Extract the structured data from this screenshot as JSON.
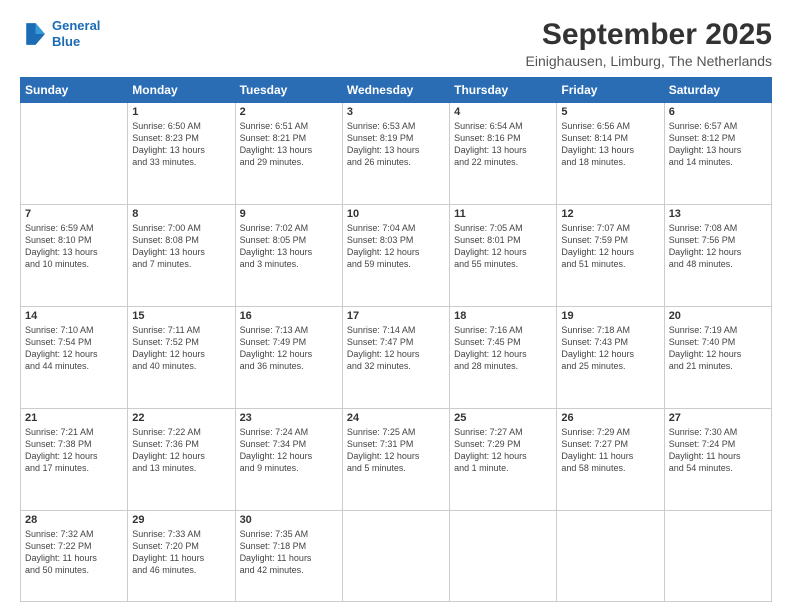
{
  "logo": {
    "line1": "General",
    "line2": "Blue"
  },
  "title": "September 2025",
  "subtitle": "Einighausen, Limburg, The Netherlands",
  "days_header": [
    "Sunday",
    "Monday",
    "Tuesday",
    "Wednesday",
    "Thursday",
    "Friday",
    "Saturday"
  ],
  "weeks": [
    [
      {
        "num": "",
        "info": ""
      },
      {
        "num": "1",
        "info": "Sunrise: 6:50 AM\nSunset: 8:23 PM\nDaylight: 13 hours\nand 33 minutes."
      },
      {
        "num": "2",
        "info": "Sunrise: 6:51 AM\nSunset: 8:21 PM\nDaylight: 13 hours\nand 29 minutes."
      },
      {
        "num": "3",
        "info": "Sunrise: 6:53 AM\nSunset: 8:19 PM\nDaylight: 13 hours\nand 26 minutes."
      },
      {
        "num": "4",
        "info": "Sunrise: 6:54 AM\nSunset: 8:16 PM\nDaylight: 13 hours\nand 22 minutes."
      },
      {
        "num": "5",
        "info": "Sunrise: 6:56 AM\nSunset: 8:14 PM\nDaylight: 13 hours\nand 18 minutes."
      },
      {
        "num": "6",
        "info": "Sunrise: 6:57 AM\nSunset: 8:12 PM\nDaylight: 13 hours\nand 14 minutes."
      }
    ],
    [
      {
        "num": "7",
        "info": "Sunrise: 6:59 AM\nSunset: 8:10 PM\nDaylight: 13 hours\nand 10 minutes."
      },
      {
        "num": "8",
        "info": "Sunrise: 7:00 AM\nSunset: 8:08 PM\nDaylight: 13 hours\nand 7 minutes."
      },
      {
        "num": "9",
        "info": "Sunrise: 7:02 AM\nSunset: 8:05 PM\nDaylight: 13 hours\nand 3 minutes."
      },
      {
        "num": "10",
        "info": "Sunrise: 7:04 AM\nSunset: 8:03 PM\nDaylight: 12 hours\nand 59 minutes."
      },
      {
        "num": "11",
        "info": "Sunrise: 7:05 AM\nSunset: 8:01 PM\nDaylight: 12 hours\nand 55 minutes."
      },
      {
        "num": "12",
        "info": "Sunrise: 7:07 AM\nSunset: 7:59 PM\nDaylight: 12 hours\nand 51 minutes."
      },
      {
        "num": "13",
        "info": "Sunrise: 7:08 AM\nSunset: 7:56 PM\nDaylight: 12 hours\nand 48 minutes."
      }
    ],
    [
      {
        "num": "14",
        "info": "Sunrise: 7:10 AM\nSunset: 7:54 PM\nDaylight: 12 hours\nand 44 minutes."
      },
      {
        "num": "15",
        "info": "Sunrise: 7:11 AM\nSunset: 7:52 PM\nDaylight: 12 hours\nand 40 minutes."
      },
      {
        "num": "16",
        "info": "Sunrise: 7:13 AM\nSunset: 7:49 PM\nDaylight: 12 hours\nand 36 minutes."
      },
      {
        "num": "17",
        "info": "Sunrise: 7:14 AM\nSunset: 7:47 PM\nDaylight: 12 hours\nand 32 minutes."
      },
      {
        "num": "18",
        "info": "Sunrise: 7:16 AM\nSunset: 7:45 PM\nDaylight: 12 hours\nand 28 minutes."
      },
      {
        "num": "19",
        "info": "Sunrise: 7:18 AM\nSunset: 7:43 PM\nDaylight: 12 hours\nand 25 minutes."
      },
      {
        "num": "20",
        "info": "Sunrise: 7:19 AM\nSunset: 7:40 PM\nDaylight: 12 hours\nand 21 minutes."
      }
    ],
    [
      {
        "num": "21",
        "info": "Sunrise: 7:21 AM\nSunset: 7:38 PM\nDaylight: 12 hours\nand 17 minutes."
      },
      {
        "num": "22",
        "info": "Sunrise: 7:22 AM\nSunset: 7:36 PM\nDaylight: 12 hours\nand 13 minutes."
      },
      {
        "num": "23",
        "info": "Sunrise: 7:24 AM\nSunset: 7:34 PM\nDaylight: 12 hours\nand 9 minutes."
      },
      {
        "num": "24",
        "info": "Sunrise: 7:25 AM\nSunset: 7:31 PM\nDaylight: 12 hours\nand 5 minutes."
      },
      {
        "num": "25",
        "info": "Sunrise: 7:27 AM\nSunset: 7:29 PM\nDaylight: 12 hours\nand 1 minute."
      },
      {
        "num": "26",
        "info": "Sunrise: 7:29 AM\nSunset: 7:27 PM\nDaylight: 11 hours\nand 58 minutes."
      },
      {
        "num": "27",
        "info": "Sunrise: 7:30 AM\nSunset: 7:24 PM\nDaylight: 11 hours\nand 54 minutes."
      }
    ],
    [
      {
        "num": "28",
        "info": "Sunrise: 7:32 AM\nSunset: 7:22 PM\nDaylight: 11 hours\nand 50 minutes."
      },
      {
        "num": "29",
        "info": "Sunrise: 7:33 AM\nSunset: 7:20 PM\nDaylight: 11 hours\nand 46 minutes."
      },
      {
        "num": "30",
        "info": "Sunrise: 7:35 AM\nSunset: 7:18 PM\nDaylight: 11 hours\nand 42 minutes."
      },
      {
        "num": "",
        "info": ""
      },
      {
        "num": "",
        "info": ""
      },
      {
        "num": "",
        "info": ""
      },
      {
        "num": "",
        "info": ""
      }
    ]
  ]
}
